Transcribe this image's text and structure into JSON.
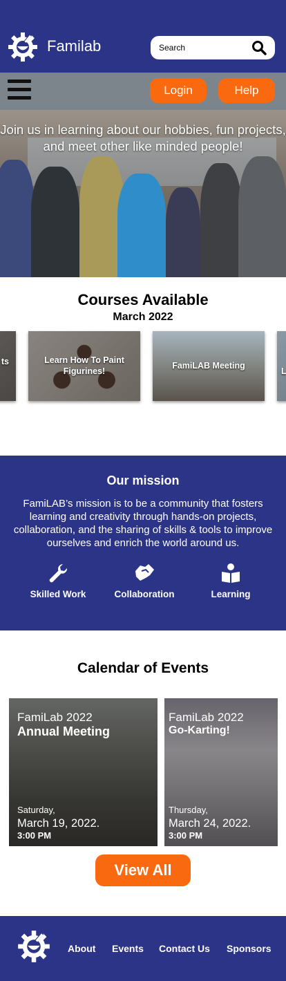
{
  "header": {
    "brand": "Familab",
    "search_label": "Search"
  },
  "nav": {
    "login": "Login",
    "help": "Help"
  },
  "hero": {
    "text": "Join us in learning about our hobbies, fun projects, and meet other like minded people!"
  },
  "courses": {
    "title": "Courses Available",
    "subtitle": "March 2022",
    "items": [
      {
        "label": "ts"
      },
      {
        "label": "Learn How To Paint Figurines!"
      },
      {
        "label": "FamiLAB Meeting"
      },
      {
        "label": "L"
      }
    ]
  },
  "mission": {
    "title": "Our mission",
    "text": "FamiLAB’s mission is to be a community that fosters learning and creativity through hands-on projects, collaboration, and the sharing of skills & tools to improve ourselves and enrich the world around us.",
    "items": [
      {
        "label": "Skilled Work",
        "icon": "wrench-icon"
      },
      {
        "label": "Collaboration",
        "icon": "handshake-icon"
      },
      {
        "label": "Learning",
        "icon": "reader-icon"
      }
    ]
  },
  "calendar": {
    "title": "Calendar of Events",
    "events": [
      {
        "org": "FamiLab 2022",
        "name": "Annual Meeting",
        "day": "Saturday,",
        "date": "March 19, 2022.",
        "time": "3:00 PM"
      },
      {
        "org": "FamiLab 2022",
        "name": "Go-Karting!",
        "day": "Thursday,",
        "date": "March 24, 2022.",
        "time": "3:00 PM"
      }
    ],
    "view_all": "View All"
  },
  "footer": {
    "links": [
      "About",
      "Events",
      "Contact Us",
      "Sponsors"
    ]
  },
  "colors": {
    "brand_blue": "#2b3487",
    "accent_orange": "#f96a10",
    "navbar_gray": "#7c858c"
  }
}
